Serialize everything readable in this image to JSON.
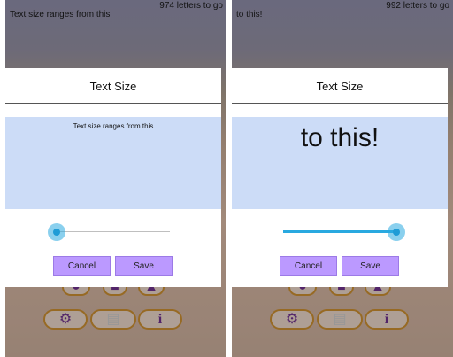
{
  "left_screen": {
    "background_text": "Text size ranges from this",
    "counter": "974 letters to go",
    "dialog": {
      "title": "Text Size",
      "preview_text": "Text size ranges from this",
      "slider_value": 0,
      "cancel_label": "Cancel",
      "save_label": "Save"
    }
  },
  "right_screen": {
    "background_text": "to this!",
    "counter": "992 letters to go",
    "dialog": {
      "title": "Text Size",
      "preview_text": "to this!",
      "slider_value": 1,
      "cancel_label": "Cancel",
      "save_label": "Save"
    }
  },
  "background_toolbar_icons": [
    "settings-icon",
    "notepad-icon",
    "info-icon"
  ],
  "colors": {
    "preview_background": "#ccdcf7",
    "button_fill": "#bb99ff",
    "slider_accent": "#29a9e0",
    "toolbar_border": "#c98b2a",
    "icon_color": "#6a2a8a"
  }
}
